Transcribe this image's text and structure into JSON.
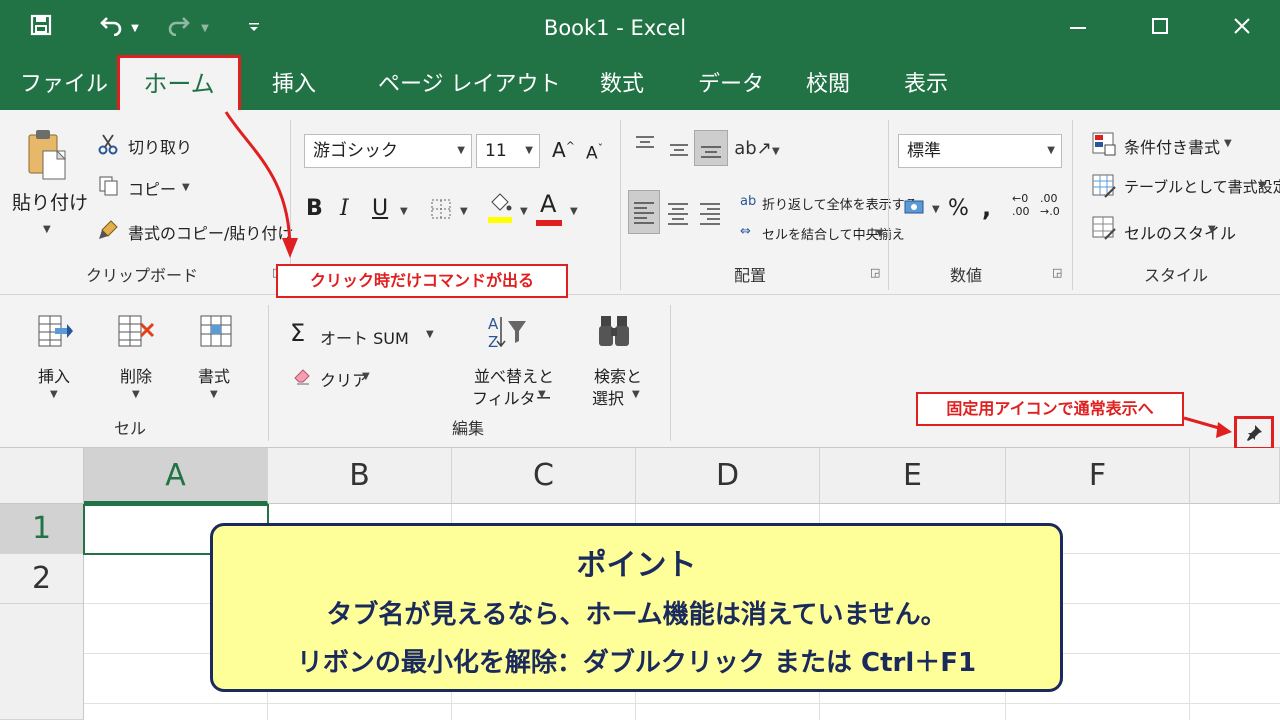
{
  "titlebar": {
    "title": "Book1  -  Excel",
    "save_icon": "save-icon",
    "undo_icon": "undo-icon",
    "redo_icon": "redo-icon",
    "customize_icon": "customize-quick-access-icon"
  },
  "tabs": {
    "file": "ファイル",
    "home": "ホーム",
    "insert": "挿入",
    "page_layout": "ページ レイアウト",
    "formulas": "数式",
    "data": "データ",
    "review": "校閲",
    "view": "表示"
  },
  "clipboard": {
    "paste": "貼り付け",
    "cut": "切り取り",
    "copy": "コピー",
    "format_painter": "書式のコピー/貼り付け",
    "label": "クリップボード"
  },
  "font": {
    "name": "游ゴシック",
    "size": "11",
    "bold": "B",
    "italic": "I",
    "underline": "U",
    "font_color_letter": "A",
    "fill_color": "#ffff00",
    "font_color": "#e02020"
  },
  "alignment": {
    "wrap_text": "折り返して全体を表示する",
    "merge_center": "セルを結合して中央揃え",
    "label": "配置"
  },
  "number": {
    "format": "標準",
    "label": "数値"
  },
  "styles": {
    "conditional": "条件付き書式",
    "format_table": "テーブルとして書式設定",
    "cell_styles": "セルのスタイル",
    "label": "スタイル"
  },
  "cells": {
    "insert": "挿入",
    "delete": "削除",
    "format": "書式",
    "label": "セル"
  },
  "editing": {
    "autosum": "オート SUM",
    "clear": "クリア",
    "sort_filter_1": "並べ替えと",
    "sort_filter_2": "フィルター",
    "find_select_1": "検索と",
    "find_select_2": "選択",
    "label": "編集"
  },
  "callouts": {
    "click_only": "クリック時だけコマンドが出る",
    "pin_note": "固定用アイコンで通常表示へ"
  },
  "grid": {
    "columns": [
      "A",
      "B",
      "C",
      "D",
      "E",
      "F"
    ],
    "rows": [
      "1",
      "2"
    ]
  },
  "point": {
    "title": "ポイント",
    "line1": "タブ名が見えるなら、ホーム機能は消えていません。",
    "line2": "リボンの最小化を解除：ダブルクリック または Ctrl＋F1"
  },
  "colors": {
    "excel_green": "#217346",
    "callout_red": "#e02020",
    "point_bg": "#ffff99",
    "point_text": "#1b2a5c"
  }
}
